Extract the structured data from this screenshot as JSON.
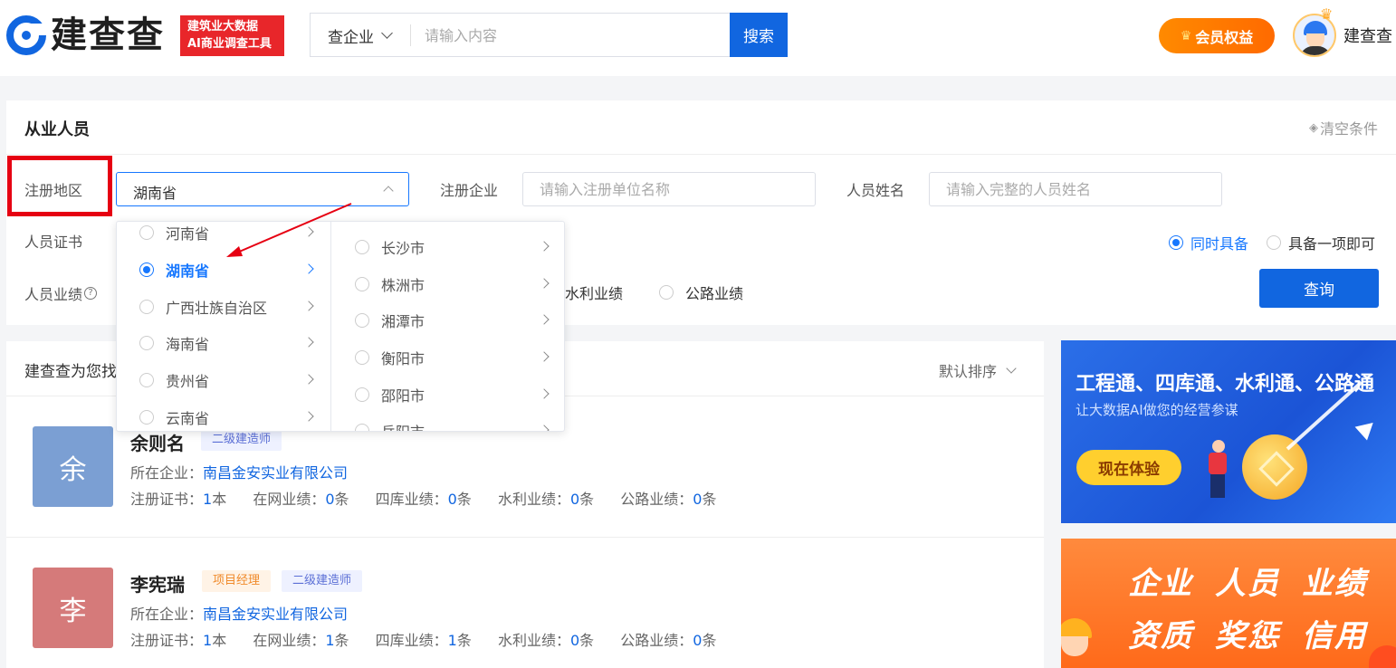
{
  "header": {
    "logo_text": "建查查",
    "logo_tag_line1": "建筑业大数据",
    "logo_tag_line2": "AI商业调查工具",
    "search_type": "查企业",
    "search_placeholder": "请输入内容",
    "search_button": "搜索",
    "vip_button": "会员权益",
    "user_name": "建查查"
  },
  "filter": {
    "title": "从业人员",
    "clear_label": "清空条件",
    "region_label": "注册地区",
    "region_value": "湖南省",
    "company_label": "注册企业",
    "company_placeholder": "请输入注册单位名称",
    "name_label": "人员姓名",
    "name_placeholder": "请输入完整的人员姓名",
    "cert_label": "人员证书",
    "match_all": "同时具备",
    "match_any": "具备一项即可",
    "perf_label": "人员业绩",
    "perf_help_icon": "?",
    "perf_options": [
      "水利业绩",
      "公路业绩"
    ],
    "query_button": "查询"
  },
  "dropdown": {
    "provinces": [
      {
        "label": "河南省",
        "selected": false
      },
      {
        "label": "湖南省",
        "selected": true
      },
      {
        "label": "广西壮族自治区",
        "selected": false
      },
      {
        "label": "海南省",
        "selected": false
      },
      {
        "label": "贵州省",
        "selected": false
      },
      {
        "label": "云南省",
        "selected": false
      }
    ],
    "cities": [
      {
        "label": "长沙市"
      },
      {
        "label": "株洲市"
      },
      {
        "label": "湘潭市"
      },
      {
        "label": "衡阳市"
      },
      {
        "label": "邵阳市"
      },
      {
        "label": "岳阳市"
      }
    ]
  },
  "results": {
    "title": "建查查为您找",
    "sort_label": "默认排序",
    "company_prefix": "所在企业：",
    "stats_labels": [
      "注册证书：",
      "在网业绩：",
      "四库业绩：",
      "水利业绩：",
      "公路业绩："
    ],
    "persons": [
      {
        "avatar_char": "余",
        "avatar_color": "#7b9fd3",
        "name": "余则名",
        "tags": [
          {
            "text": "二级建造师",
            "style": "blue"
          }
        ],
        "company": "南昌金安实业有限公司",
        "stats": [
          {
            "num": "1",
            "unit": "本"
          },
          {
            "num": "0",
            "unit": "条"
          },
          {
            "num": "0",
            "unit": "条"
          },
          {
            "num": "0",
            "unit": "条"
          },
          {
            "num": "0",
            "unit": "条"
          }
        ]
      },
      {
        "avatar_char": "李",
        "avatar_color": "#d57a7a",
        "name": "李宪瑞",
        "tags": [
          {
            "text": "项目经理",
            "style": "orange"
          },
          {
            "text": "二级建造师",
            "style": "blue"
          }
        ],
        "company": "南昌金安实业有限公司",
        "stats": [
          {
            "num": "1",
            "unit": "本"
          },
          {
            "num": "1",
            "unit": "条"
          },
          {
            "num": "1",
            "unit": "条"
          },
          {
            "num": "0",
            "unit": "条"
          },
          {
            "num": "0",
            "unit": "条"
          }
        ]
      }
    ]
  },
  "banners": {
    "b1_title": "工程通、四库通、水利通、公路通",
    "b1_sub": "让大数据AI做您的经营参谋",
    "b1_button": "现在体验",
    "b2_row1": [
      "企业",
      "人员",
      "业绩"
    ],
    "b2_row2": [
      "资质",
      "奖惩",
      "信用"
    ]
  },
  "colors": {
    "primary": "#1166e0",
    "highlight": "#e60012",
    "vip": "#ff7a00"
  }
}
